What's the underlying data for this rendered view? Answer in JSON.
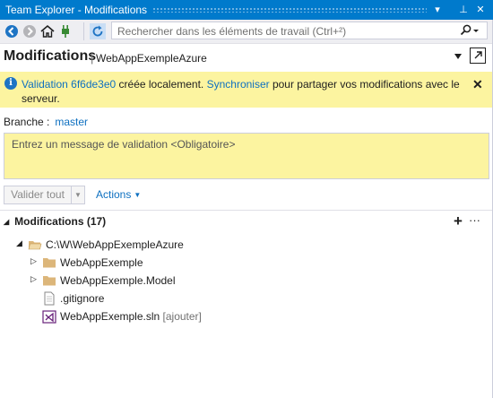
{
  "window": {
    "title": "Team Explorer - Modifications"
  },
  "title_buttons": {
    "dropdown": "▾",
    "pin": "⊥",
    "close": "✕"
  },
  "toolbar": {
    "search_placeholder": "Rechercher dans les éléments de travail (Ctrl+²)"
  },
  "header": {
    "page_title": "Modifications",
    "separator": "|",
    "repo_name": "WebAppExempleAzure"
  },
  "infobar": {
    "prefix": "Validation 6f6de3e0",
    "middle": " créée localement. ",
    "sync_link": "Synchroniser",
    "suffix": " pour partager vos modifications avec le serveur."
  },
  "branch": {
    "label": "Branche :",
    "value": "master"
  },
  "commit": {
    "message_placeholder": "Entrez un message de validation <Obligatoire>",
    "commit_all_label": "Valider tout",
    "actions_label": "Actions"
  },
  "changes": {
    "section_label": "Modifications (17)",
    "tree": [
      {
        "label": "C:\\W\\WebAppExempleAzure",
        "icon": "folder-open-icon",
        "expander": "◢",
        "tag": ""
      },
      {
        "label": "WebAppExemple",
        "icon": "folder-icon",
        "expander": "▷",
        "tag": ""
      },
      {
        "label": "WebAppExemple.Model",
        "icon": "folder-icon",
        "expander": "▷",
        "tag": ""
      },
      {
        "label": ".gitignore",
        "icon": "file-icon",
        "expander": "",
        "tag": ""
      },
      {
        "label": "WebAppExemple.sln",
        "icon": "solution-icon",
        "expander": "",
        "tag": "[ajouter]"
      }
    ]
  },
  "colors": {
    "accent": "#007acc",
    "info_background": "#fcf4a0",
    "link": "#0e70c0",
    "folder": "#dcb67a"
  }
}
